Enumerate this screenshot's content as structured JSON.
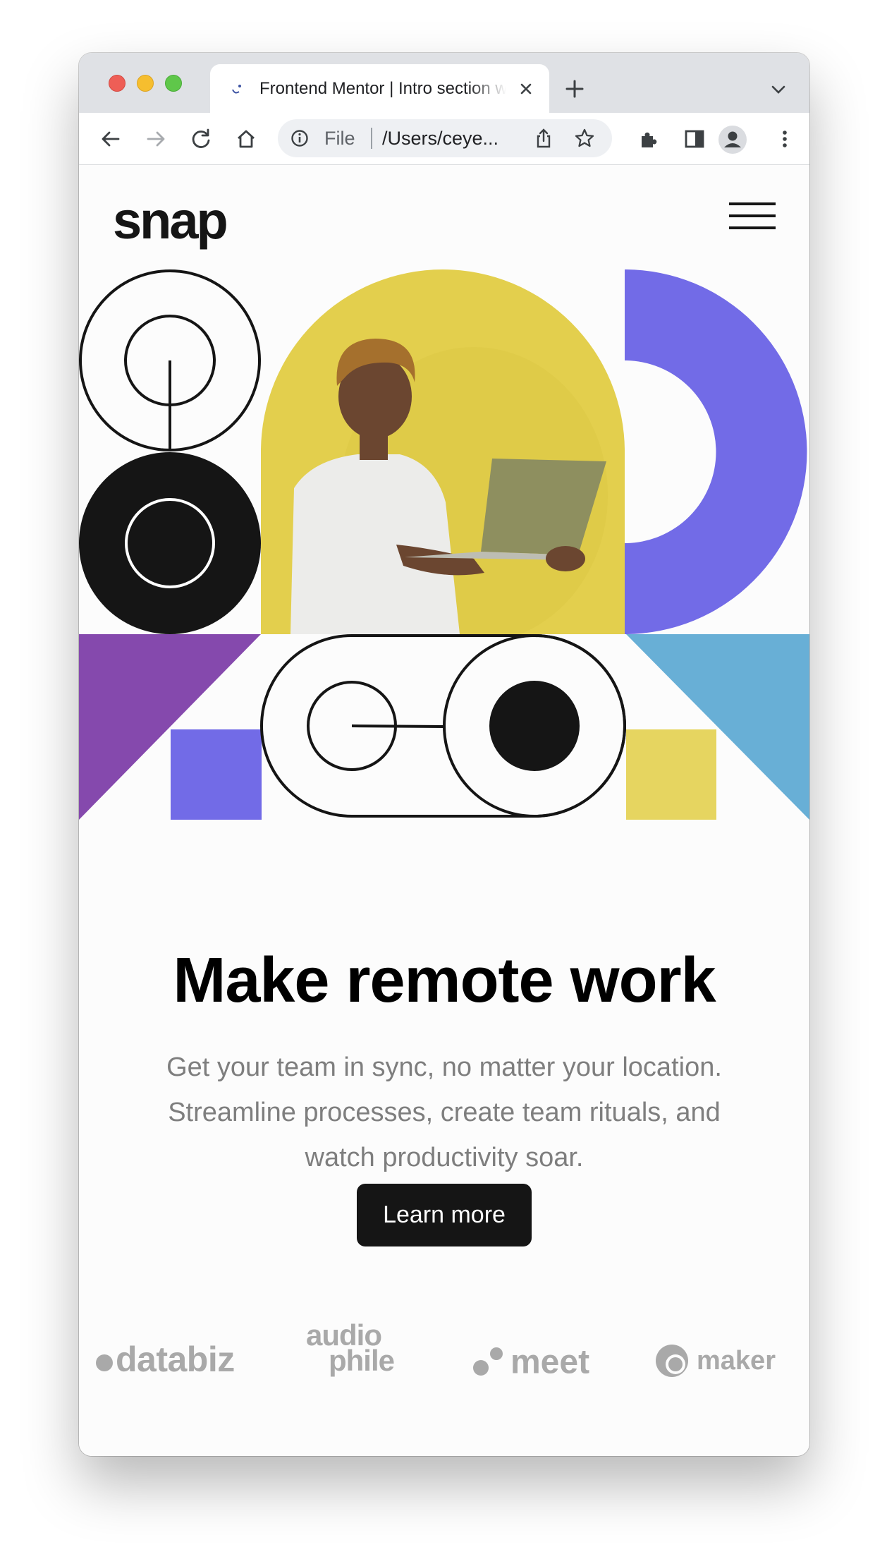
{
  "browser": {
    "tab_title": "Frontend Mentor | Intro section with dropdown navigation",
    "address_scheme": "File",
    "address_url": "/Users/ceye...",
    "icons": [
      "back-icon",
      "forward-icon",
      "reload-icon",
      "home-icon",
      "info-icon",
      "share-icon",
      "star-icon",
      "extensions-icon",
      "sidebar-icon",
      "profile-icon",
      "menu-dots-icon",
      "close-icon",
      "plus-icon",
      "chevron-down-icon"
    ]
  },
  "site": {
    "logo": "snap",
    "headline": "Make remote work",
    "description": "Get your team in sync, no matter your location. Streamline processes, create team rituals, and watch productivity soar.",
    "cta_label": "Learn more",
    "clients": {
      "databiz": "databiz",
      "audiophile_top": "audio",
      "audiophile_bottom": "phile",
      "meet": "meet",
      "maker": "maker"
    }
  },
  "colors": {
    "dark": "#151515",
    "purple": "#726be7",
    "violet": "#8549ad",
    "blue": "#68afd6",
    "yellow": "#e6d560",
    "photo_bg": "#e3cf4d",
    "muted_text": "#7e7e7e",
    "client_gray": "#a9a9a9"
  }
}
